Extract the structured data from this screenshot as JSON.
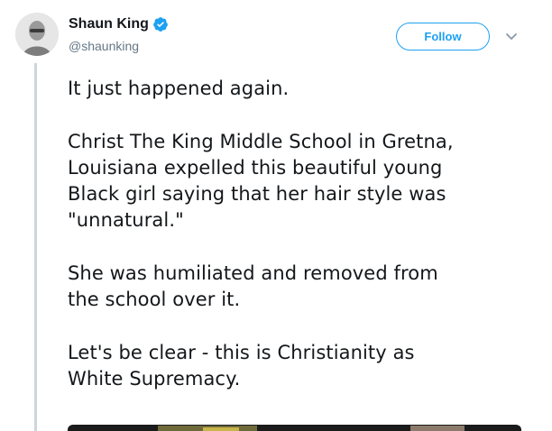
{
  "author": {
    "display_name": "Shaun King",
    "handle": "@shaunking",
    "verified": true
  },
  "actions": {
    "follow_label": "Follow"
  },
  "tweet": {
    "paragraphs": [
      "It just happened again.",
      "Christ The King Middle School in Gretna,\nLouisiana expelled this beautiful young\nBlack girl saying that her hair style was\n\"unnatural.\"",
      "She was humiliated and removed from\nthe school over it.",
      "Let's be clear - this is Christianity as\nWhite Supremacy."
    ]
  },
  "colors": {
    "accent": "#1da1f2",
    "text": "#14171a",
    "secondary_text": "#657786",
    "thread_line": "#ccd6dd"
  }
}
